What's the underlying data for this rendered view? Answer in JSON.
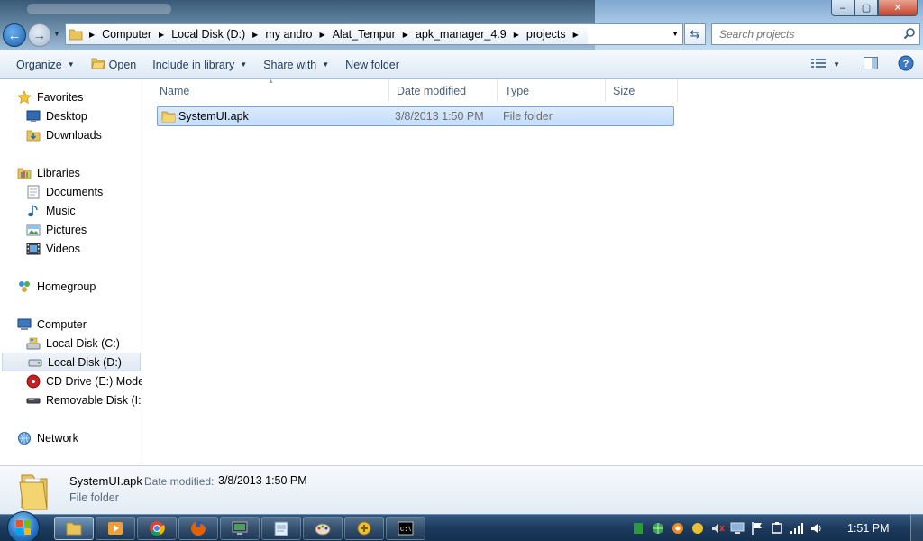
{
  "window": {
    "controls": {
      "minimize": "–",
      "maximize": "▢",
      "close": "✕"
    }
  },
  "address": {
    "crumbs": [
      "Computer",
      "Local Disk (D:)",
      "my andro",
      "Alat_Tempur",
      "apk_manager_4.9",
      "projects"
    ]
  },
  "search": {
    "placeholder": "Search projects"
  },
  "toolbar": {
    "organize": "Organize",
    "open": "Open",
    "include": "Include in library",
    "share": "Share with",
    "new_folder": "New folder"
  },
  "nav": {
    "favorites": "Favorites",
    "desktop": "Desktop",
    "downloads": "Downloads",
    "libraries": "Libraries",
    "documents": "Documents",
    "music": "Music",
    "pictures": "Pictures",
    "videos": "Videos",
    "homegroup": "Homegroup",
    "computer": "Computer",
    "disk_c": "Local Disk (C:)",
    "disk_d": "Local Disk (D:)",
    "cd_drive": "CD Drive (E:) Moden",
    "removable": "Removable Disk (I:)",
    "network": "Network"
  },
  "columns": {
    "name": "Name",
    "date": "Date modified",
    "type": "Type",
    "size": "Size"
  },
  "files": [
    {
      "name": "SystemUI.apk",
      "date": "3/8/2013 1:50 PM",
      "type": "File folder",
      "size": ""
    }
  ],
  "details": {
    "name": "SystemUI.apk",
    "date_label": "Date modified:",
    "date_value": "3/8/2013 1:50 PM",
    "type": "File folder"
  },
  "taskbar": {
    "clock": "1:51 PM"
  },
  "colors": {
    "accent": "#1e395b",
    "selection": "#c1dcfc",
    "taskbar": "#1c3a5c"
  }
}
